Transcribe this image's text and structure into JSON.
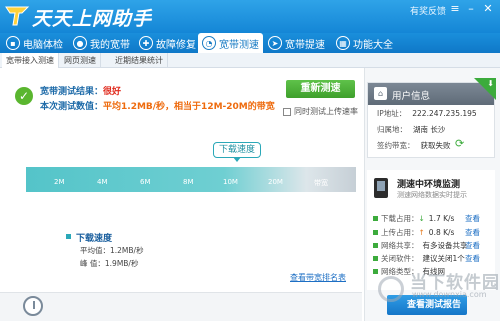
{
  "app": {
    "title": "天天上网助手",
    "feedback": "有奖反馈"
  },
  "nav": {
    "tabs": [
      {
        "label": "电脑体检",
        "icon": "monitor-icon"
      },
      {
        "label": "我的宽带",
        "icon": "globe-icon"
      },
      {
        "label": "故障修复",
        "icon": "wrench-icon"
      },
      {
        "label": "宽带测速",
        "icon": "speedometer-icon",
        "active": true
      },
      {
        "label": "宽带提速",
        "icon": "rocket-icon"
      },
      {
        "label": "功能大全",
        "icon": "grid-icon"
      }
    ]
  },
  "subtabs": [
    "宽带接入测速",
    "网页测速",
    "近期结果统计"
  ],
  "result": {
    "label1": "宽带测试结果：",
    "value1": "很好",
    "label2": "本次测试数值：",
    "value2": "平均1.2MB/秒，相当于12M-20M的带宽",
    "retest": "重新测速",
    "upload_check": "同时测试上传速率"
  },
  "gauge": {
    "bubble": "下载速度",
    "ticks": [
      "2M",
      "4M",
      "6M",
      "8M",
      "10M",
      "20M",
      "带宽"
    ]
  },
  "download": {
    "title": "下载速度",
    "avg_label": "平均值：",
    "avg_value": "1.2MB/秒",
    "peak_label": "峰  值：",
    "peak_value": "1.9MB/秒",
    "detail_link": "查看带宽排名表"
  },
  "netinfo": {
    "title": "用户信息",
    "ip_label": "IP地址：",
    "ip": "222.247.235.195",
    "isp_label": "归属地：",
    "isp": "湖南 长沙",
    "contract_label": "签约带宽：",
    "contract": "获取失败"
  },
  "env": {
    "title": "测速中环境监测",
    "subtitle": "测速网络数据实时提示",
    "rows": [
      {
        "label": "下载占用：",
        "value": "1.7 K/s",
        "link": "查看",
        "color": "#3cab3c",
        "arrow": "↓"
      },
      {
        "label": "上传占用：",
        "value": "0.8 K/s",
        "link": "查看",
        "color": "#e67a1e",
        "arrow": "↑"
      },
      {
        "label": "网络共享：",
        "value": "有多设备共享",
        "link": "查看",
        "color": "#3cab3c"
      },
      {
        "label": "关闭软件：",
        "value": "建议关闭1个",
        "link": "查看",
        "color": "#3cab3c"
      },
      {
        "label": "网络类型：",
        "value": "有线网",
        "link": "",
        "color": "#3cab3c"
      }
    ],
    "report_button": "查看测试报告"
  },
  "watermark": {
    "text": "当下软件园",
    "url": "www.downxia.com"
  }
}
